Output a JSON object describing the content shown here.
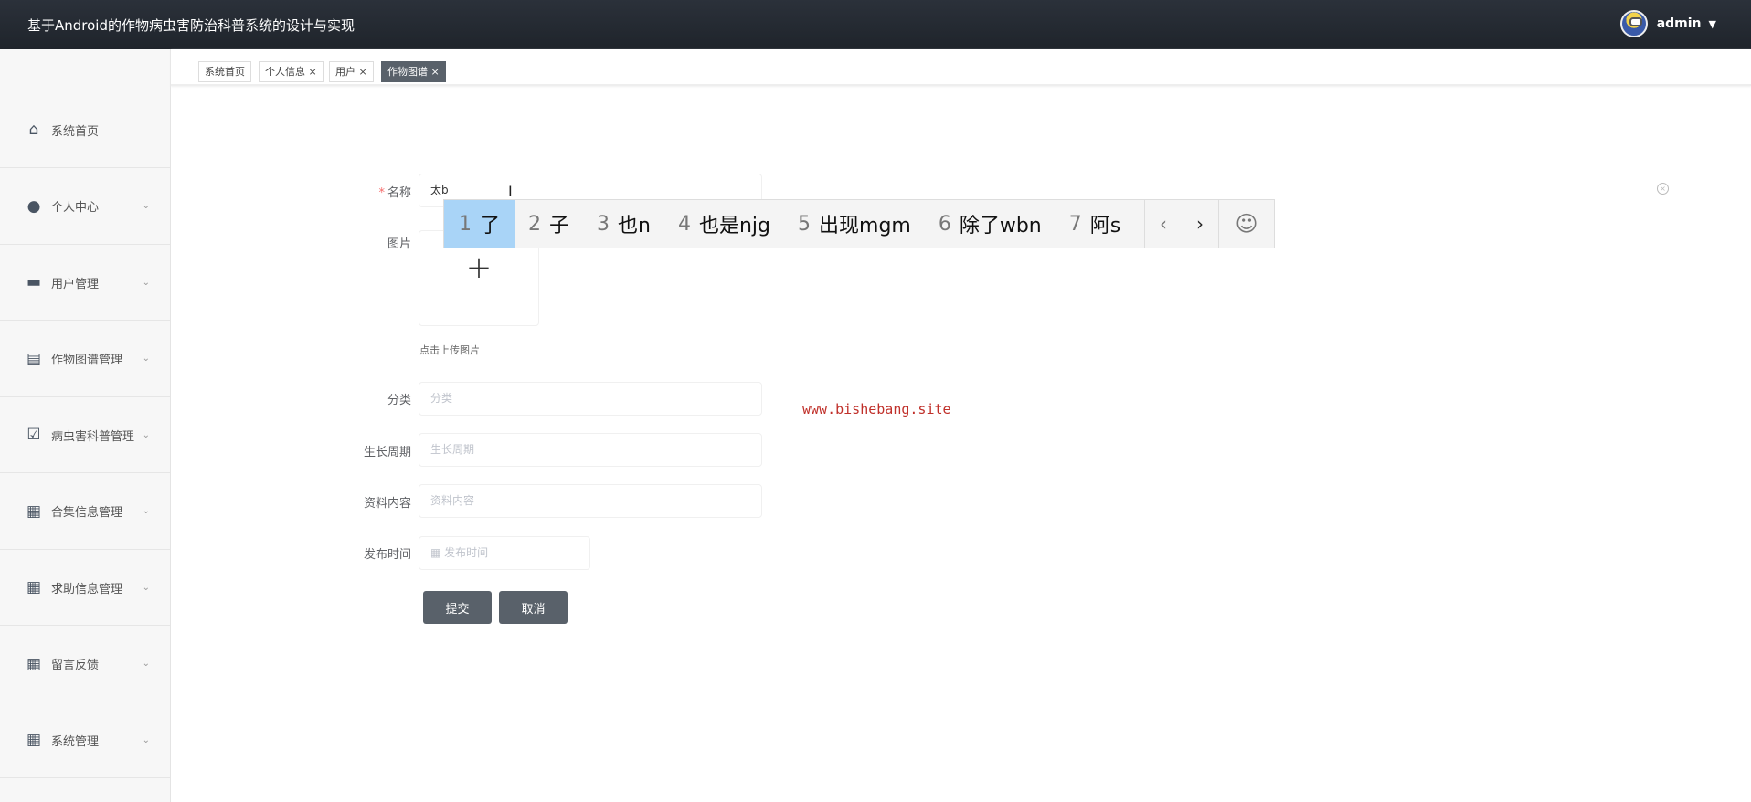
{
  "header": {
    "title": "基于Android的作物病虫害防治科普系统的设计与实现",
    "user": "admin"
  },
  "sidebar": {
    "items": [
      {
        "label": "系统首页",
        "icon": "home-icon",
        "chev": false
      },
      {
        "label": "个人中心",
        "icon": "user-icon",
        "chev": true
      },
      {
        "label": "用户管理",
        "icon": "briefcase-icon",
        "chev": true
      },
      {
        "label": "作物图谱管理",
        "icon": "clipboard-icon",
        "chev": true
      },
      {
        "label": "病虫害科普管理",
        "icon": "clipboard-check-icon",
        "chev": true
      },
      {
        "label": "合集信息管理",
        "icon": "grid-icon",
        "chev": true
      },
      {
        "label": "求助信息管理",
        "icon": "grid-icon",
        "chev": true
      },
      {
        "label": "留言反馈",
        "icon": "grid-icon",
        "chev": true
      },
      {
        "label": "系统管理",
        "icon": "grid-icon",
        "chev": true
      }
    ]
  },
  "tabs": [
    {
      "label": "系统首页"
    },
    {
      "label": "个人信息 ×"
    },
    {
      "label": "用户 ×"
    },
    {
      "label": "作物图谱 ×"
    }
  ],
  "form": {
    "name_label": "名称",
    "name_value": "太b",
    "image_label": "图片",
    "upload_plus": "+",
    "upload_hint": "点击上传图片",
    "category_label": "分类",
    "category_placeholder": "分类",
    "cycle_label": "生长周期",
    "cycle_placeholder": "生长周期",
    "content_label": "资料内容",
    "content_placeholder": "资料内容",
    "date_label": "发布时间",
    "date_placeholder": "发布时间",
    "submit": "提交",
    "cancel": "取消"
  },
  "ime": {
    "candidates": [
      {
        "n": "1",
        "t": "了"
      },
      {
        "n": "2",
        "t": "子"
      },
      {
        "n": "3",
        "t": "也n"
      },
      {
        "n": "4",
        "t": "也是njg"
      },
      {
        "n": "5",
        "t": "出现mgm"
      },
      {
        "n": "6",
        "t": "除了wbn"
      },
      {
        "n": "7",
        "t": "阿s"
      }
    ],
    "prev": "‹",
    "next": "›",
    "emoji": "☺"
  },
  "watermark": "www.bishebang.site"
}
